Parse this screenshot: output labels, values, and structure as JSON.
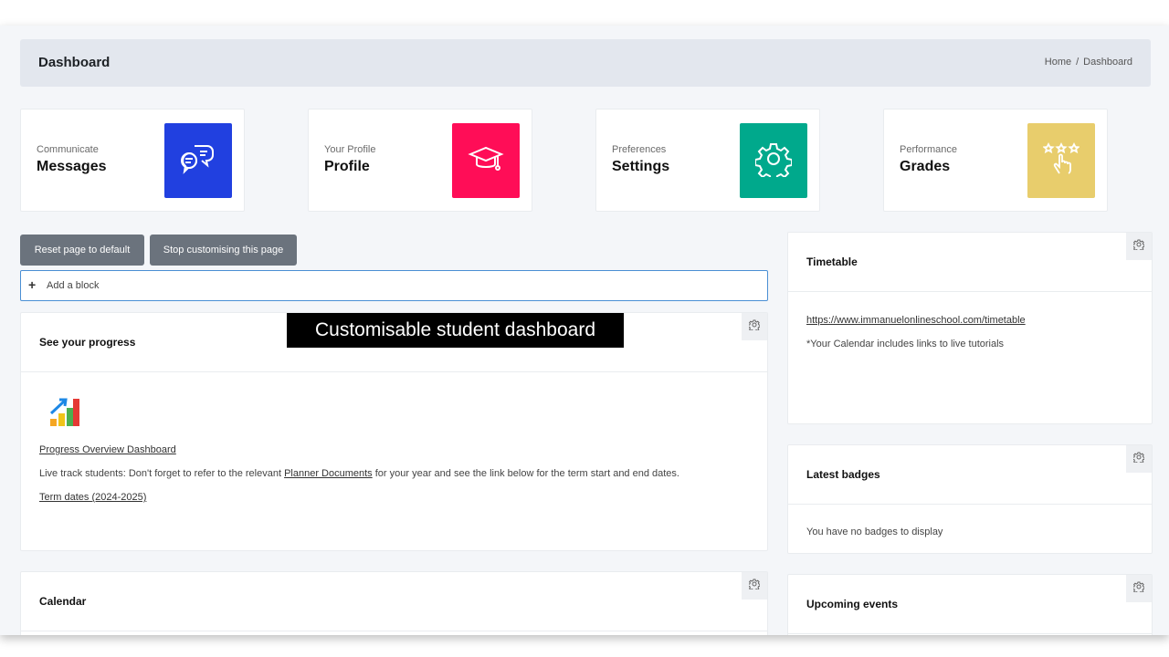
{
  "header": {
    "title": "Dashboard",
    "breadcrumb": [
      "Home",
      "Dashboard"
    ],
    "breadcrumb_separator": "/"
  },
  "cards": [
    {
      "category": "Communicate",
      "title": "Messages",
      "color": "#2140e0",
      "icon": "chat-bubbles-icon"
    },
    {
      "category": "Your Profile",
      "title": "Profile",
      "color": "#ff0d57",
      "icon": "graduation-cap-icon"
    },
    {
      "category": "Preferences",
      "title": "Settings",
      "color": "#00a98c",
      "icon": "gear-icon"
    },
    {
      "category": "Performance",
      "title": "Grades",
      "color": "#e8cd6c",
      "icon": "stars-hand-icon"
    }
  ],
  "buttons": {
    "reset": "Reset page to default",
    "stop": "Stop customising this page"
  },
  "add_block": {
    "icon": "+",
    "label": "Add a block"
  },
  "progress": {
    "title": "See your progress",
    "link": "Progress Overview Dashboard",
    "text_before": "Live track students: Don't forget to refer to the relevant ",
    "planner_link": "Planner Documents",
    "text_after": " for your year and see the link below for the term start and end dates.",
    "term_link": "Term dates (2024-2025)"
  },
  "calendar": {
    "title": "Calendar"
  },
  "timetable": {
    "title": "Timetable",
    "url": "https://www.immanuelonlineschool.com/timetable",
    "note": "*Your Calendar includes links to live tutorials"
  },
  "badges": {
    "title": "Latest badges",
    "empty": "You have no badges to display"
  },
  "events": {
    "title": "Upcoming events"
  },
  "caption": "Customisable student dashboard"
}
